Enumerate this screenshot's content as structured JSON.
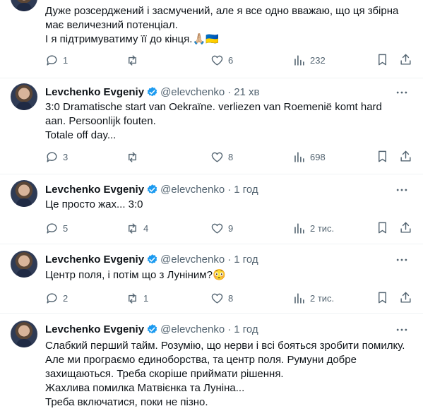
{
  "author": {
    "name": "Levchenko Evgeniy",
    "handle": "@elevchenko"
  },
  "colors": {
    "verified": "#1d9bf0",
    "icon": "#536471",
    "text": "#0f1419",
    "divider": "#eff3f4"
  },
  "tweets": [
    {
      "lines": [
        "Дуже розсерджений і засмучений,  але я все одно вважаю, що ця збірна",
        "має величезний потенціал.",
        "І я підтримуватиму її до кінця.🙏🏼🇺🇦"
      ],
      "replies": "1",
      "retweets": "",
      "likes": "6",
      "views": "232"
    },
    {
      "time": "21 хв",
      "lines": [
        "3:0 Dramatische start van Oekraïne.  verliezen van Roemenië komt hard",
        "aan. Persoonlijk fouten.",
        "Totale off day..."
      ],
      "replies": "3",
      "retweets": "",
      "likes": "8",
      "views": "698"
    },
    {
      "time": "1 год",
      "lines": [
        "Це просто жах... 3:0"
      ],
      "replies": "5",
      "retweets": "4",
      "likes": "9",
      "views": "2 тис."
    },
    {
      "time": "1 год",
      "lines": [
        "Центр поля, і потім що з Луніним?😳"
      ],
      "replies": "2",
      "retweets": "1",
      "likes": "8",
      "views": "2 тис."
    },
    {
      "time": "1 год",
      "lines": [
        "Слабкий перший тайм. Розумію, що нерви і всі бояться зробити помилку.",
        "Але ми програємо единоборства, та центр поля. Румуни добре",
        "захищаються. Треба скоріше приймати рішення.",
        "Жахлива помилка Матвієнка та Луніна...",
        "Треба включатися, поки не пізно."
      ]
    }
  ]
}
